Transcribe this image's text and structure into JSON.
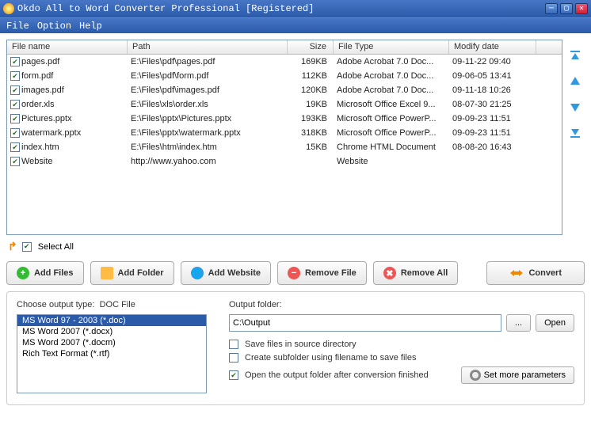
{
  "titlebar": {
    "title": "Okdo All to Word Converter Professional [Registered]"
  },
  "menu": {
    "file": "File",
    "option": "Option",
    "help": "Help"
  },
  "columns": {
    "name": "File name",
    "path": "Path",
    "size": "Size",
    "type": "File Type",
    "date": "Modify date"
  },
  "rows": [
    {
      "name": "pages.pdf",
      "path": "E:\\Files\\pdf\\pages.pdf",
      "size": "169KB",
      "type": "Adobe Acrobat 7.0 Doc...",
      "date": "09-11-22 09:40"
    },
    {
      "name": "form.pdf",
      "path": "E:\\Files\\pdf\\form.pdf",
      "size": "112KB",
      "type": "Adobe Acrobat 7.0 Doc...",
      "date": "09-06-05 13:41"
    },
    {
      "name": "images.pdf",
      "path": "E:\\Files\\pdf\\images.pdf",
      "size": "120KB",
      "type": "Adobe Acrobat 7.0 Doc...",
      "date": "09-11-18 10:26"
    },
    {
      "name": "order.xls",
      "path": "E:\\Files\\xls\\order.xls",
      "size": "19KB",
      "type": "Microsoft Office Excel 9...",
      "date": "08-07-30 21:25"
    },
    {
      "name": "Pictures.pptx",
      "path": "E:\\Files\\pptx\\Pictures.pptx",
      "size": "193KB",
      "type": "Microsoft Office PowerP...",
      "date": "09-09-23 11:51"
    },
    {
      "name": "watermark.pptx",
      "path": "E:\\Files\\pptx\\watermark.pptx",
      "size": "318KB",
      "type": "Microsoft Office PowerP...",
      "date": "09-09-23 11:51"
    },
    {
      "name": "index.htm",
      "path": "E:\\Files\\htm\\index.htm",
      "size": "15KB",
      "type": "Chrome HTML Document",
      "date": "08-08-20 16:43"
    },
    {
      "name": "Website",
      "path": "http://www.yahoo.com",
      "size": "",
      "type": "Website",
      "date": ""
    }
  ],
  "selectall": "Select All",
  "buttons": {
    "addfiles": "Add Files",
    "addfolder": "Add Folder",
    "addwebsite": "Add Website",
    "removefile": "Remove File",
    "removeall": "Remove All",
    "convert": "Convert"
  },
  "output": {
    "choose_label": "Choose output type:",
    "choose_value": "DOC File",
    "types": [
      "MS Word 97 - 2003 (*.doc)",
      "MS Word 2007 (*.docx)",
      "MS Word 2007 (*.docm)",
      "Rich Text Format (*.rtf)"
    ],
    "folder_label": "Output folder:",
    "folder_value": "C:\\Output",
    "browse": "...",
    "open": "Open",
    "opt_source": "Save files in source directory",
    "opt_subfolder": "Create subfolder using filename to save files",
    "opt_openafter": "Open the output folder after conversion finished",
    "params": "Set more parameters"
  }
}
